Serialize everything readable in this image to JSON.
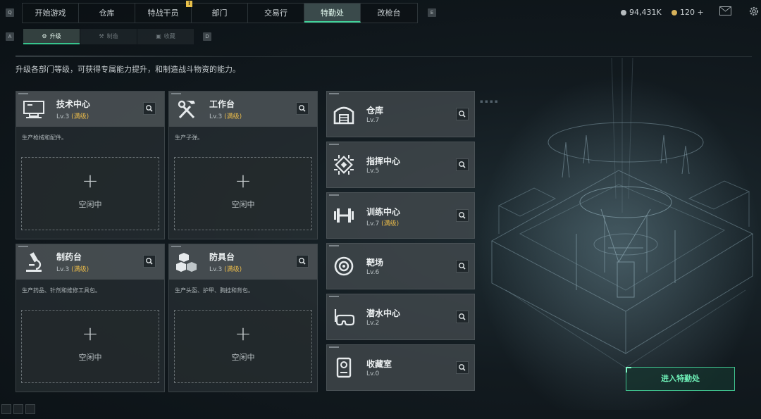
{
  "topnav": {
    "left_key": "Q",
    "right_key": "E",
    "tabs": [
      {
        "label": "开始游戏"
      },
      {
        "label": "仓库"
      },
      {
        "label": "特战干员"
      },
      {
        "label": "部门"
      },
      {
        "label": "交易行"
      },
      {
        "label": "特勤处"
      },
      {
        "label": "改枪台"
      }
    ],
    "active_tab": "特勤处",
    "badge": "!",
    "currency_silver": "94,431K",
    "currency_gold": "120 +",
    "mail_icon": "mail-icon",
    "settings_icon": "gear-icon"
  },
  "subnav": {
    "left_key": "A",
    "right_key": "D",
    "tabs": [
      {
        "label": "升级",
        "icon": "upgrade-icon"
      },
      {
        "label": "制造",
        "icon": "craft-icon"
      },
      {
        "label": "收藏",
        "icon": "collection-icon"
      }
    ],
    "active_tab": "升级"
  },
  "description": "升级各部门等级，可获得专属能力提升，和制造战斗物资的能力。",
  "big_facilities": [
    {
      "name": "技术中心",
      "level": "Lv.3",
      "max_label": "(满级)",
      "desc": "生产枪械和配件。",
      "slot_label": "空闲中",
      "icon": "computer-icon"
    },
    {
      "name": "工作台",
      "level": "Lv.3",
      "max_label": "(满级)",
      "desc": "生产子弹。",
      "slot_label": "空闲中",
      "icon": "tools-icon"
    },
    {
      "name": "制药台",
      "level": "Lv.3",
      "max_label": "(满级)",
      "desc": "生产药品、针剂和维修工具包。",
      "slot_label": "空闲中",
      "icon": "microscope-icon"
    },
    {
      "name": "防具台",
      "level": "Lv.3",
      "max_label": "(满级)",
      "desc": "生产头盔、护甲、胸挂和背包。",
      "slot_label": "空闲中",
      "icon": "boxes-icon"
    }
  ],
  "small_facilities": [
    {
      "name": "仓库",
      "level": "Lv.7",
      "max_label": "",
      "icon": "warehouse-icon"
    },
    {
      "name": "指挥中心",
      "level": "Lv.5",
      "max_label": "",
      "icon": "chip-icon"
    },
    {
      "name": "训练中心",
      "level": "Lv.7",
      "max_label": "(满级)",
      "icon": "dumbbell-icon"
    },
    {
      "name": "靶场",
      "level": "Lv.6",
      "max_label": "",
      "icon": "target-icon"
    },
    {
      "name": "潜水中心",
      "level": "Lv.2",
      "max_label": "",
      "icon": "diving-mask-icon"
    },
    {
      "name": "收藏室",
      "level": "Lv.0",
      "max_label": "",
      "icon": "trophy-case-icon"
    }
  ],
  "scene": {
    "enter_button": "进入特勤处"
  },
  "colors": {
    "accent": "#41d39a",
    "max_level": "#e7b94a"
  }
}
